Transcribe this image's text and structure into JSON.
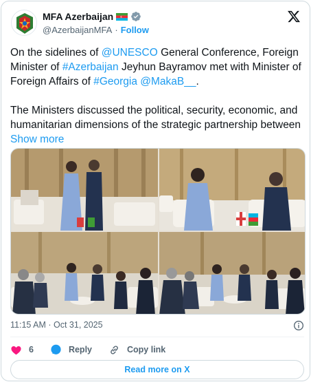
{
  "account": {
    "name": "MFA Azerbaijan",
    "flag_icon": "azerbaijan-flag-icon",
    "verified_icon": "gray-verified-badge-icon",
    "handle": "@AzerbaijanMFA",
    "separator": "·",
    "follow_label": "Follow"
  },
  "post": {
    "p1_a": "On the sidelines of ",
    "p1_mention_unesco": "@UNESCO",
    "p1_b": " General Conference, Foreign Minister of ",
    "p1_hashtag_azerbaijan": "#Azerbaijan",
    "p1_c": " Jeyhun Bayramov met with Minister of Foreign Affairs of ",
    "p1_hashtag_georgia": "#Georgia",
    "p1_d": " ",
    "p1_mention_makab": "@MakaB__",
    "p1_e": ".",
    "p2": "The Ministers discussed the political, security, economic, and humanitarian dimensions of the strategic partnership between ",
    "show_more": "Show more"
  },
  "photos": [
    "photo-handshake",
    "photo-seated-pair",
    "photo-delegation-wide",
    "photo-delegation-angle"
  ],
  "timestamp": "11:15 AM · Oct 31, 2025",
  "actions": {
    "like_count": "6",
    "reply_label": "Reply",
    "copy_label": "Copy link"
  },
  "read_more_label": "Read more on X",
  "colors": {
    "link": "#1d9bf0",
    "like": "#f91880",
    "border": "#cfd9de",
    "muted": "#536471"
  }
}
